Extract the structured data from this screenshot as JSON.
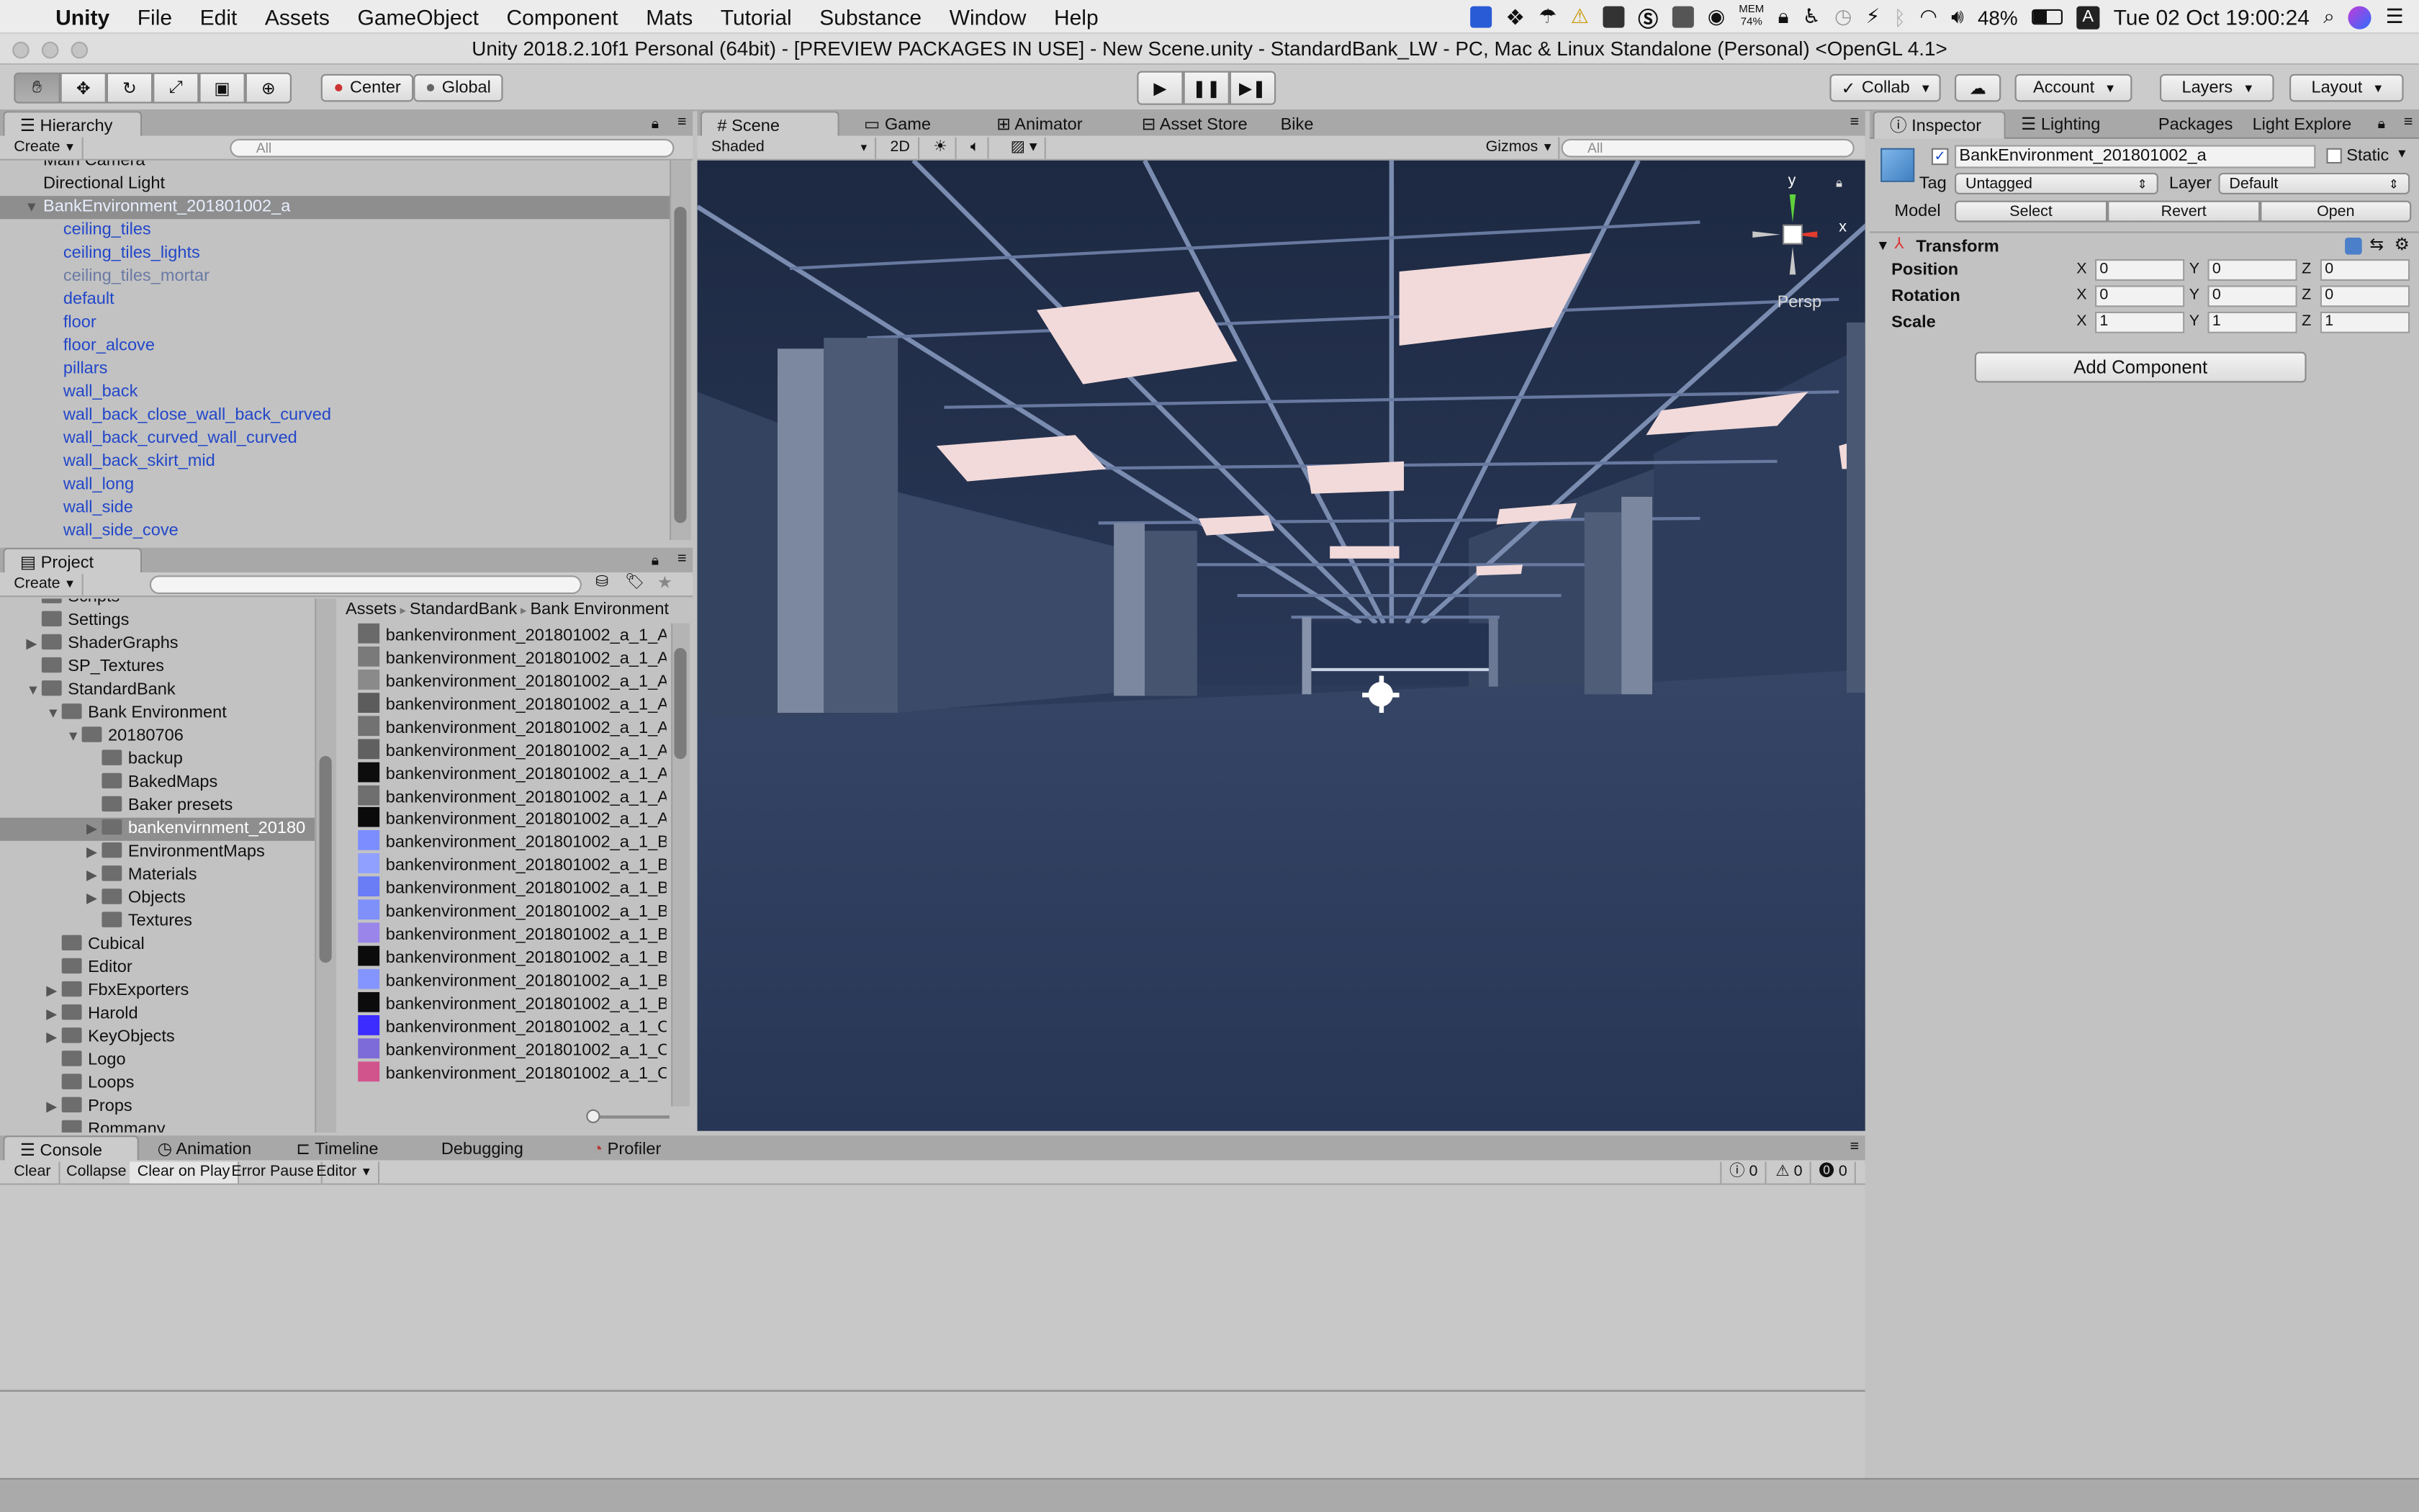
{
  "menubar": {
    "app": "Unity",
    "items": [
      "File",
      "Edit",
      "Assets",
      "GameObject",
      "Component",
      "Mats",
      "Tutorial",
      "Substance",
      "Window",
      "Help"
    ],
    "battery": "48%",
    "mem_label": "MEM",
    "mem_value": "74%",
    "clock": "Tue 02 Oct  19:00:24",
    "input_source": "A"
  },
  "window": {
    "title": "Unity 2018.2.10f1 Personal (64bit) - [PREVIEW PACKAGES IN USE] - New Scene.unity - StandardBank_LW - PC, Mac & Linux Standalone (Personal) <OpenGL 4.1>"
  },
  "toolbar": {
    "pivot": "Center",
    "space": "Global",
    "collab": "Collab",
    "account": "Account",
    "layers": "Layers",
    "layout": "Layout"
  },
  "hierarchy": {
    "tab": "Hierarchy",
    "create": "Create",
    "search_placeholder": "All",
    "items": [
      {
        "label": "Main Camera",
        "style": "normal",
        "indent": 0
      },
      {
        "label": "Directional Light",
        "style": "normal",
        "indent": 0
      },
      {
        "label": "BankEnvironment_201801002_a",
        "style": "selected",
        "indent": 0
      },
      {
        "label": "ceiling_tiles",
        "style": "blue",
        "indent": 1
      },
      {
        "label": "ceiling_tiles_lights",
        "style": "blue",
        "indent": 1
      },
      {
        "label": "ceiling_tiles_mortar",
        "style": "gray",
        "indent": 1
      },
      {
        "label": "default",
        "style": "blue",
        "indent": 1
      },
      {
        "label": "floor",
        "style": "blue",
        "indent": 1
      },
      {
        "label": "floor_alcove",
        "style": "blue",
        "indent": 1
      },
      {
        "label": "pillars",
        "style": "blue",
        "indent": 1
      },
      {
        "label": "wall_back",
        "style": "blue",
        "indent": 1
      },
      {
        "label": "wall_back_close_wall_back_curved",
        "style": "blue",
        "indent": 1
      },
      {
        "label": "wall_back_curved_wall_curved",
        "style": "blue",
        "indent": 1
      },
      {
        "label": "wall_back_skirt_mid",
        "style": "blue",
        "indent": 1
      },
      {
        "label": "wall_long",
        "style": "blue",
        "indent": 1
      },
      {
        "label": "wall_side",
        "style": "blue",
        "indent": 1
      },
      {
        "label": "wall_side_cove",
        "style": "blue",
        "indent": 1
      }
    ]
  },
  "project": {
    "tab": "Project",
    "create": "Create",
    "breadcrumb": [
      "Assets",
      "StandardBank",
      "Bank Environment"
    ],
    "tree": [
      {
        "label": "Scripts",
        "indent": 1,
        "arrow": ""
      },
      {
        "label": "Settings",
        "indent": 1,
        "arrow": ""
      },
      {
        "label": "ShaderGraphs",
        "indent": 1,
        "arrow": "▶"
      },
      {
        "label": "SP_Textures",
        "indent": 1,
        "arrow": ""
      },
      {
        "label": "StandardBank",
        "indent": 1,
        "arrow": "▼"
      },
      {
        "label": "Bank Environment",
        "indent": 2,
        "arrow": "▼"
      },
      {
        "label": "20180706",
        "indent": 3,
        "arrow": "▼"
      },
      {
        "label": "backup",
        "indent": 4,
        "arrow": ""
      },
      {
        "label": "BakedMaps",
        "indent": 4,
        "arrow": ""
      },
      {
        "label": "Baker presets",
        "indent": 4,
        "arrow": ""
      },
      {
        "label": "bankenvirnment_20180",
        "indent": 4,
        "arrow": "▶",
        "selected": true
      },
      {
        "label": "EnvironmentMaps",
        "indent": 4,
        "arrow": "▶"
      },
      {
        "label": "Materials",
        "indent": 4,
        "arrow": "▶"
      },
      {
        "label": "Objects",
        "indent": 4,
        "arrow": "▶"
      },
      {
        "label": "Textures",
        "indent": 4,
        "arrow": ""
      },
      {
        "label": "Cubical",
        "indent": 2,
        "arrow": ""
      },
      {
        "label": "Editor",
        "indent": 2,
        "arrow": ""
      },
      {
        "label": "FbxExporters",
        "indent": 2,
        "arrow": "▶"
      },
      {
        "label": "Harold",
        "indent": 2,
        "arrow": "▶"
      },
      {
        "label": "KeyObjects",
        "indent": 2,
        "arrow": "▶"
      },
      {
        "label": "Logo",
        "indent": 2,
        "arrow": ""
      },
      {
        "label": "Loops",
        "indent": 2,
        "arrow": ""
      },
      {
        "label": "Props",
        "indent": 2,
        "arrow": "▶"
      },
      {
        "label": "Rommany",
        "indent": 2,
        "arrow": ""
      }
    ],
    "assets": [
      {
        "name": "bankenvironment_201801002_a_1_A",
        "color": "#6a6a6a"
      },
      {
        "name": "bankenvironment_201801002_a_1_A",
        "color": "#7a7a7a"
      },
      {
        "name": "bankenvironment_201801002_a_1_A",
        "color": "#8a8a8a"
      },
      {
        "name": "bankenvironment_201801002_a_1_A",
        "color": "#5c5c5c"
      },
      {
        "name": "bankenvironment_201801002_a_1_A",
        "color": "#727272"
      },
      {
        "name": "bankenvironment_201801002_a_1_A",
        "color": "#606060"
      },
      {
        "name": "bankenvironment_201801002_a_1_A",
        "color": "#0d0d0d"
      },
      {
        "name": "bankenvironment_201801002_a_1_A",
        "color": "#6f6f6f"
      },
      {
        "name": "bankenvironment_201801002_a_1_A",
        "color": "#0a0a0a"
      },
      {
        "name": "bankenvironment_201801002_a_1_B",
        "color": "#7b8dff"
      },
      {
        "name": "bankenvironment_201801002_a_1_B",
        "color": "#8fa0ff"
      },
      {
        "name": "bankenvironment_201801002_a_1_B",
        "color": "#6a7cf6"
      },
      {
        "name": "bankenvironment_201801002_a_1_B",
        "color": "#7f90fb"
      },
      {
        "name": "bankenvironment_201801002_a_1_B",
        "color": "#9a86ea"
      },
      {
        "name": "bankenvironment_201801002_a_1_B",
        "color": "#0b0b0b"
      },
      {
        "name": "bankenvironment_201801002_a_1_B",
        "color": "#8595ff"
      },
      {
        "name": "bankenvironment_201801002_a_1_B",
        "color": "#0c0c0c"
      },
      {
        "name": "bankenvironment_201801002_a_1_C",
        "color": "#3c2cff"
      },
      {
        "name": "bankenvironment_201801002_a_1_C",
        "color": "#7d6bd9"
      },
      {
        "name": "bankenvironment_201801002_a_1_C",
        "color": "#d2548d"
      }
    ]
  },
  "scene": {
    "tabs": [
      "Scene",
      "Game",
      "Animator",
      "Asset Store",
      "Bike"
    ],
    "shading": "Shaded",
    "mode2d": "2D",
    "gizmos": "Gizmos",
    "search_placeholder": "All",
    "persp": "Persp",
    "axis_y": "y",
    "axis_x": "x"
  },
  "inspector": {
    "tabs": [
      "Inspector",
      "Lighting",
      "Packages",
      "Light Explore"
    ],
    "object_name": "BankEnvironment_201801002_a",
    "static": "Static",
    "tag_label": "Tag",
    "tag": "Untagged",
    "layer_label": "Layer",
    "layer": "Default",
    "model_label": "Model",
    "select": "Select",
    "revert": "Revert",
    "open": "Open",
    "component": "Transform",
    "rows": [
      {
        "label": "Position",
        "x": "0",
        "y": "0",
        "z": "0"
      },
      {
        "label": "Rotation",
        "x": "0",
        "y": "0",
        "z": "0"
      },
      {
        "label": "Scale",
        "x": "1",
        "y": "1",
        "z": "1"
      }
    ],
    "axis_x": "X",
    "axis_y": "Y",
    "axis_z": "Z",
    "add_component": "Add Component"
  },
  "console": {
    "tabs": [
      "Console",
      "Animation",
      "Timeline",
      "Debugging",
      "Profiler"
    ],
    "buttons": [
      "Clear",
      "Collapse",
      "Clear on Play",
      "Error Pause",
      "Editor"
    ],
    "log_count": "0",
    "warn_count": "0",
    "error_count": "0"
  }
}
